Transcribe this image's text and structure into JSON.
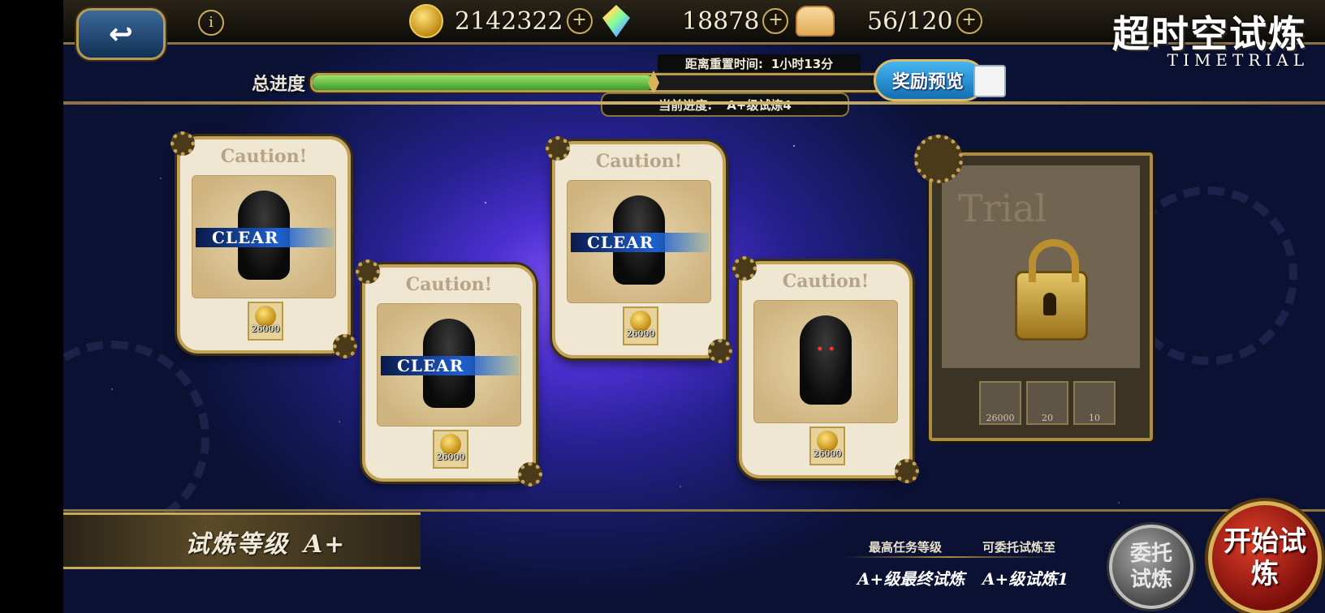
{
  "header": {
    "coins": "2142322",
    "gems": "18878",
    "stamina": "56/120",
    "title_cn": "超时空试炼",
    "title_en": "TIMETRIAL"
  },
  "progress": {
    "label": "总进度",
    "fill_fraction": 0.6,
    "reset_label": "距离重置时间:",
    "reset_value": "1小时13分",
    "current_label": "当前进度:",
    "current_value": "A+级试炼4",
    "reward_preview": "奖励预览"
  },
  "cards": [
    {
      "caution": "Caution!",
      "status": "CLEAR",
      "reward": "26000"
    },
    {
      "caution": "Caution!",
      "status": "CLEAR",
      "reward": "26000"
    },
    {
      "caution": "Caution!",
      "status": "CLEAR",
      "reward": "26000"
    },
    {
      "caution": "Caution!",
      "status": "",
      "reward": "26000"
    }
  ],
  "locked_card": {
    "title": "Trial",
    "rewards": [
      "26000",
      "20",
      "10"
    ]
  },
  "bottom": {
    "grade_label": "试炼等级",
    "grade_value": "A+",
    "max_level_label": "最高任务等级",
    "max_level_value": "A+级最终试炼",
    "delegate_label": "可委托试炼至",
    "delegate_value": "A+级试炼1",
    "delegate_button": "委托试炼",
    "start_button": "开始试炼"
  },
  "colors": {
    "accent_gold": "#c9aa5e",
    "progress_green": "#3d9a2a",
    "start_red": "#b3180f"
  }
}
